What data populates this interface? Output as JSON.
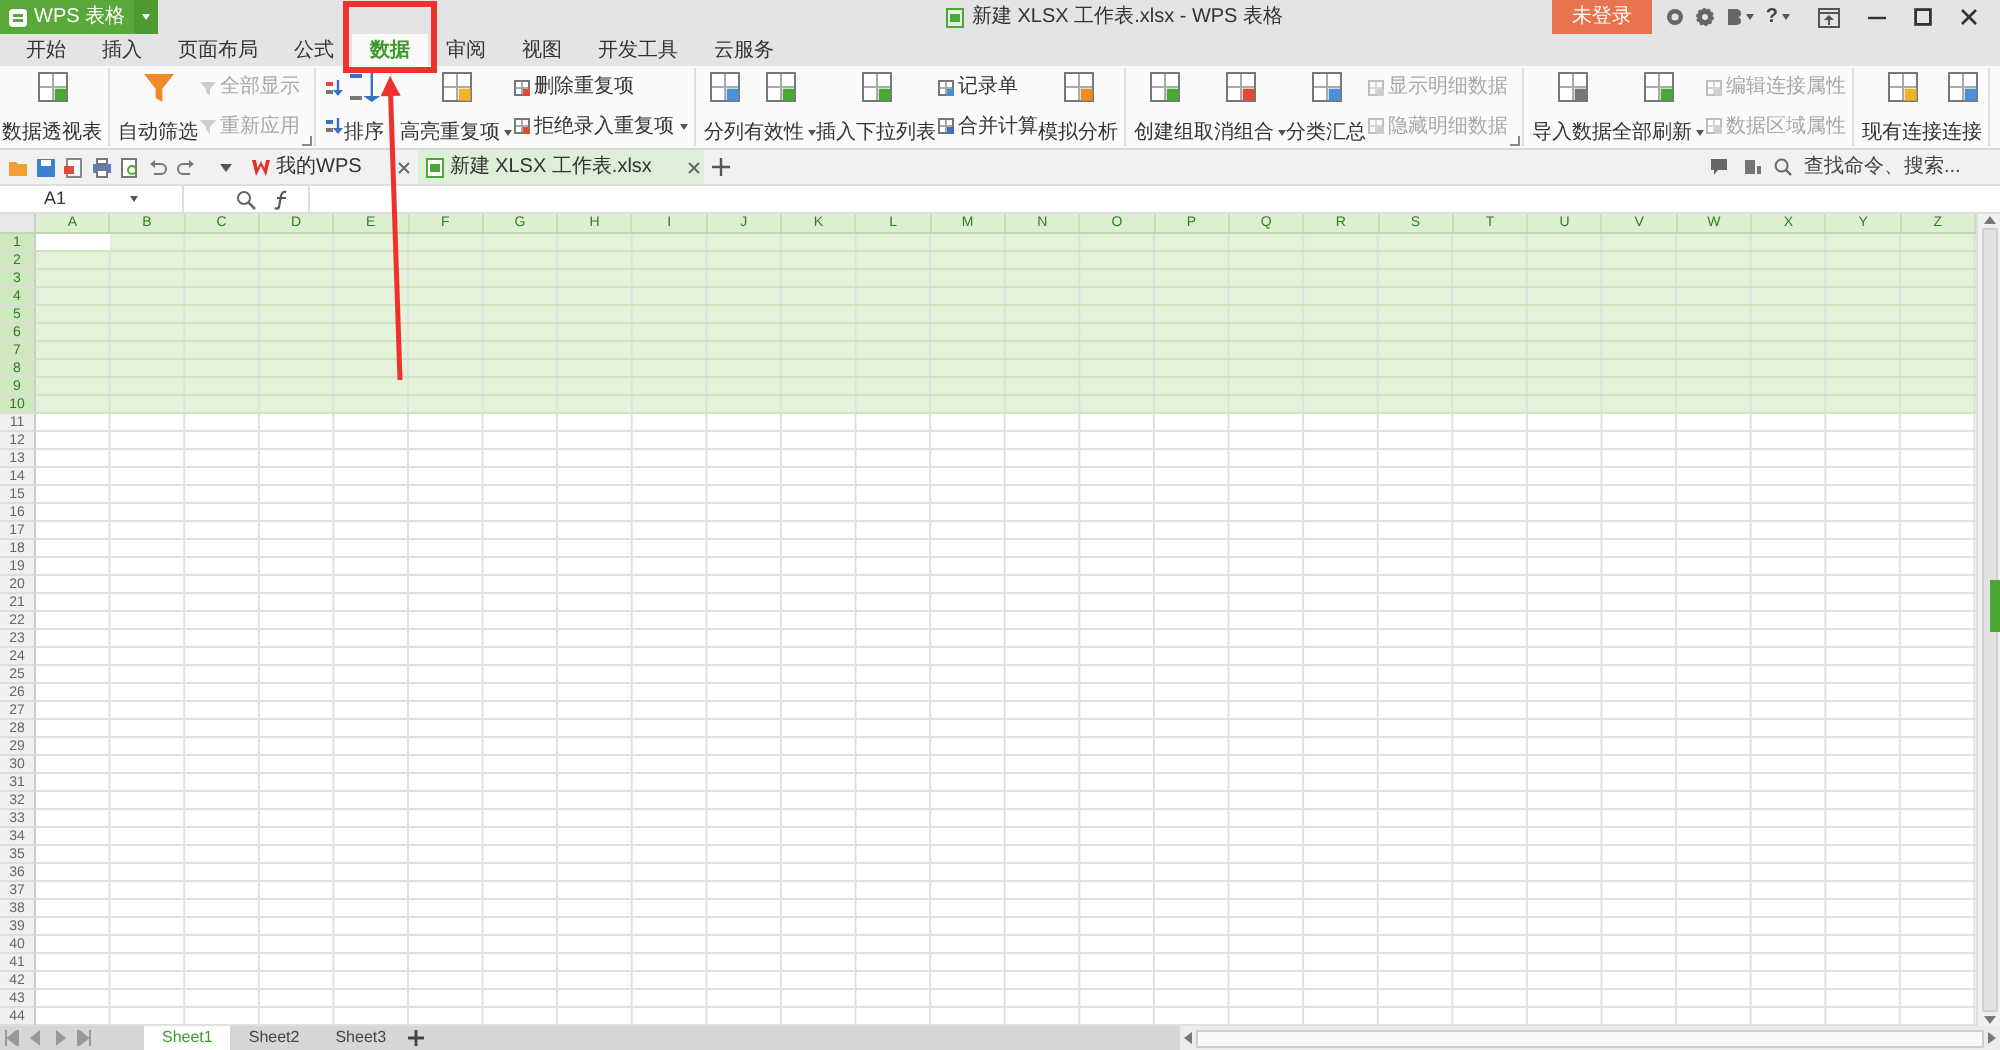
{
  "title_bar": {
    "app_button": "WPS 表格",
    "title": "新建 XLSX 工作表.xlsx - WPS 表格",
    "login_button": "未登录",
    "help": "?"
  },
  "tabs": [
    {
      "label": "开始",
      "selected": false
    },
    {
      "label": "插入",
      "selected": false
    },
    {
      "label": "页面布局",
      "selected": false
    },
    {
      "label": "公式",
      "selected": false
    },
    {
      "label": "数据",
      "selected": true
    },
    {
      "label": "审阅",
      "selected": false
    },
    {
      "label": "视图",
      "selected": false
    },
    {
      "label": "开发工具",
      "selected": false
    },
    {
      "label": "云服务",
      "selected": false
    }
  ],
  "ribbon": {
    "groups": [
      {
        "items": [
          {
            "kind": "large",
            "label": "数据透视表",
            "dropdown": false,
            "disabled": false
          }
        ]
      },
      {
        "launcher": true,
        "items": [
          {
            "kind": "large",
            "label": "自动筛选",
            "dropdown": false,
            "disabled": false
          },
          {
            "kind": "small",
            "label": "全部显示",
            "dropdown": false,
            "disabled": true
          },
          {
            "kind": "small",
            "label": "重新应用",
            "dropdown": false,
            "disabled": true
          }
        ]
      },
      {
        "items": [
          {
            "kind": "icon",
            "dropdown": false,
            "disabled": false
          },
          {
            "kind": "icon",
            "dropdown": false,
            "disabled": false
          },
          {
            "kind": "large",
            "label": "排序",
            "dropdown": false,
            "disabled": false
          }
        ]
      },
      {
        "items": [
          {
            "kind": "large",
            "label": "高亮重复项",
            "dropdown": true,
            "disabled": false
          },
          {
            "kind": "small",
            "label": "删除重复项",
            "dropdown": false,
            "disabled": false
          },
          {
            "kind": "small",
            "label": "拒绝录入重复项",
            "dropdown": true,
            "disabled": false
          }
        ]
      },
      {
        "items": [
          {
            "kind": "large",
            "label": "分列",
            "dropdown": false,
            "disabled": false
          },
          {
            "kind": "large",
            "label": "有效性",
            "dropdown": true,
            "disabled": false
          },
          {
            "kind": "large",
            "label": "插入下拉列表",
            "dropdown": false,
            "disabled": false
          },
          {
            "kind": "small",
            "label": "记录单",
            "dropdown": false,
            "disabled": false
          },
          {
            "kind": "small",
            "label": "合并计算",
            "dropdown": false,
            "disabled": false
          },
          {
            "kind": "large",
            "label": "模拟分析",
            "dropdown": false,
            "disabled": false
          }
        ]
      },
      {
        "launcher": true,
        "items": [
          {
            "kind": "large",
            "label": "创建组",
            "dropdown": false,
            "disabled": false
          },
          {
            "kind": "large",
            "label": "取消组合",
            "dropdown": true,
            "disabled": false
          },
          {
            "kind": "large",
            "label": "分类汇总",
            "dropdown": false,
            "disabled": false
          },
          {
            "kind": "small",
            "label": "显示明细数据",
            "dropdown": false,
            "disabled": true
          },
          {
            "kind": "small",
            "label": "隐藏明细数据",
            "dropdown": false,
            "disabled": true
          }
        ]
      },
      {
        "items": [
          {
            "kind": "large",
            "label": "导入数据",
            "dropdown": false,
            "disabled": false
          },
          {
            "kind": "large",
            "label": "全部刷新",
            "dropdown": true,
            "disabled": false
          },
          {
            "kind": "small",
            "label": "编辑连接属性",
            "dropdown": false,
            "disabled": true
          },
          {
            "kind": "small",
            "label": "数据区域属性",
            "dropdown": false,
            "disabled": true
          }
        ]
      },
      {
        "items": [
          {
            "kind": "large",
            "label": "现有连接",
            "dropdown": false,
            "disabled": false
          },
          {
            "kind": "large",
            "label": "连接",
            "dropdown": false,
            "disabled": false
          }
        ]
      }
    ]
  },
  "doc_tabs": [
    {
      "kind": "home",
      "label": "我的WPS",
      "selected": false
    },
    {
      "kind": "sheet",
      "label": "新建 XLSX 工作表.xlsx",
      "selected": true
    }
  ],
  "search": {
    "placeholder": "查找命令、搜索..."
  },
  "formula_bar": {
    "name_box": "A1"
  },
  "columns": [
    {
      "label": "A",
      "selected": true,
      "active": true
    },
    {
      "label": "B",
      "selected": true,
      "active": false
    },
    {
      "label": "C",
      "selected": true,
      "active": false
    },
    {
      "label": "D",
      "selected": true,
      "active": false
    },
    {
      "label": "E",
      "selected": true,
      "active": false
    },
    {
      "label": "F",
      "selected": true,
      "active": false
    },
    {
      "label": "G",
      "selected": true,
      "active": false
    },
    {
      "label": "H",
      "selected": true,
      "active": false
    },
    {
      "label": "I",
      "selected": true,
      "active": false
    },
    {
      "label": "J",
      "selected": true,
      "active": false
    },
    {
      "label": "K",
      "selected": true,
      "active": false
    },
    {
      "label": "L",
      "selected": true,
      "active": false
    },
    {
      "label": "M",
      "selected": true,
      "active": false
    },
    {
      "label": "N",
      "selected": true,
      "active": false
    },
    {
      "label": "O",
      "selected": true,
      "active": false
    },
    {
      "label": "P",
      "selected": true,
      "active": false
    },
    {
      "label": "Q",
      "selected": true,
      "active": false
    },
    {
      "label": "R",
      "selected": true,
      "active": false
    },
    {
      "label": "S",
      "selected": true,
      "active": false
    },
    {
      "label": "T",
      "selected": true,
      "active": false
    },
    {
      "label": "U",
      "selected": true,
      "active": false
    },
    {
      "label": "V",
      "selected": true,
      "active": false
    },
    {
      "label": "W",
      "selected": true,
      "active": false
    },
    {
      "label": "X",
      "selected": true,
      "active": false
    },
    {
      "label": "Y",
      "selected": true,
      "active": false
    },
    {
      "label": "Z",
      "selected": true,
      "active": false
    }
  ],
  "rows": [
    {
      "label": "1",
      "selected": true,
      "active": true
    },
    {
      "label": "2",
      "selected": true,
      "active": false
    },
    {
      "label": "3",
      "selected": true,
      "active": false
    },
    {
      "label": "4",
      "selected": true,
      "active": false
    },
    {
      "label": "5",
      "selected": true,
      "active": false
    },
    {
      "label": "6",
      "selected": true,
      "active": false
    },
    {
      "label": "7",
      "selected": true,
      "active": false
    },
    {
      "label": "8",
      "selected": true,
      "active": false
    },
    {
      "label": "9",
      "selected": true,
      "active": false
    },
    {
      "label": "10",
      "selected": true,
      "active": false
    },
    {
      "label": "11",
      "selected": false,
      "active": false
    },
    {
      "label": "12",
      "selected": false,
      "active": false
    },
    {
      "label": "13",
      "selected": false,
      "active": false
    },
    {
      "label": "14",
      "selected": false,
      "active": false
    },
    {
      "label": "15",
      "selected": false,
      "active": false
    },
    {
      "label": "16",
      "selected": false,
      "active": false
    },
    {
      "label": "17",
      "selected": false,
      "active": false
    },
    {
      "label": "18",
      "selected": false,
      "active": false
    },
    {
      "label": "19",
      "selected": false,
      "active": false
    },
    {
      "label": "20",
      "selected": false,
      "active": false
    },
    {
      "label": "21",
      "selected": false,
      "active": false
    },
    {
      "label": "22",
      "selected": false,
      "active": false
    },
    {
      "label": "23",
      "selected": false,
      "active": false
    },
    {
      "label": "24",
      "selected": false,
      "active": false
    },
    {
      "label": "25",
      "selected": false,
      "active": false
    },
    {
      "label": "26",
      "selected": false,
      "active": false
    },
    {
      "label": "27",
      "selected": false,
      "active": false
    },
    {
      "label": "28",
      "selected": false,
      "active": false
    },
    {
      "label": "29",
      "selected": false,
      "active": false
    },
    {
      "label": "30",
      "selected": false,
      "active": false
    },
    {
      "label": "31",
      "selected": false,
      "active": false
    },
    {
      "label": "32",
      "selected": false,
      "active": false
    },
    {
      "label": "33",
      "selected": false,
      "active": false
    },
    {
      "label": "34",
      "selected": false,
      "active": false
    },
    {
      "label": "35",
      "selected": false,
      "active": false
    },
    {
      "label": "36",
      "selected": false,
      "active": false
    },
    {
      "label": "37",
      "selected": false,
      "active": false
    },
    {
      "label": "38",
      "selected": false,
      "active": false
    },
    {
      "label": "39",
      "selected": false,
      "active": false
    },
    {
      "label": "40",
      "selected": false,
      "active": false
    },
    {
      "label": "41",
      "selected": false,
      "active": false
    },
    {
      "label": "42",
      "selected": false,
      "active": false
    },
    {
      "label": "43",
      "selected": false,
      "active": false
    },
    {
      "label": "44",
      "selected": false,
      "active": false
    }
  ],
  "sheet_tabs": [
    {
      "label": "Sheet1",
      "selected": true
    },
    {
      "label": "Sheet2",
      "selected": false
    },
    {
      "label": "Sheet3",
      "selected": false
    }
  ]
}
